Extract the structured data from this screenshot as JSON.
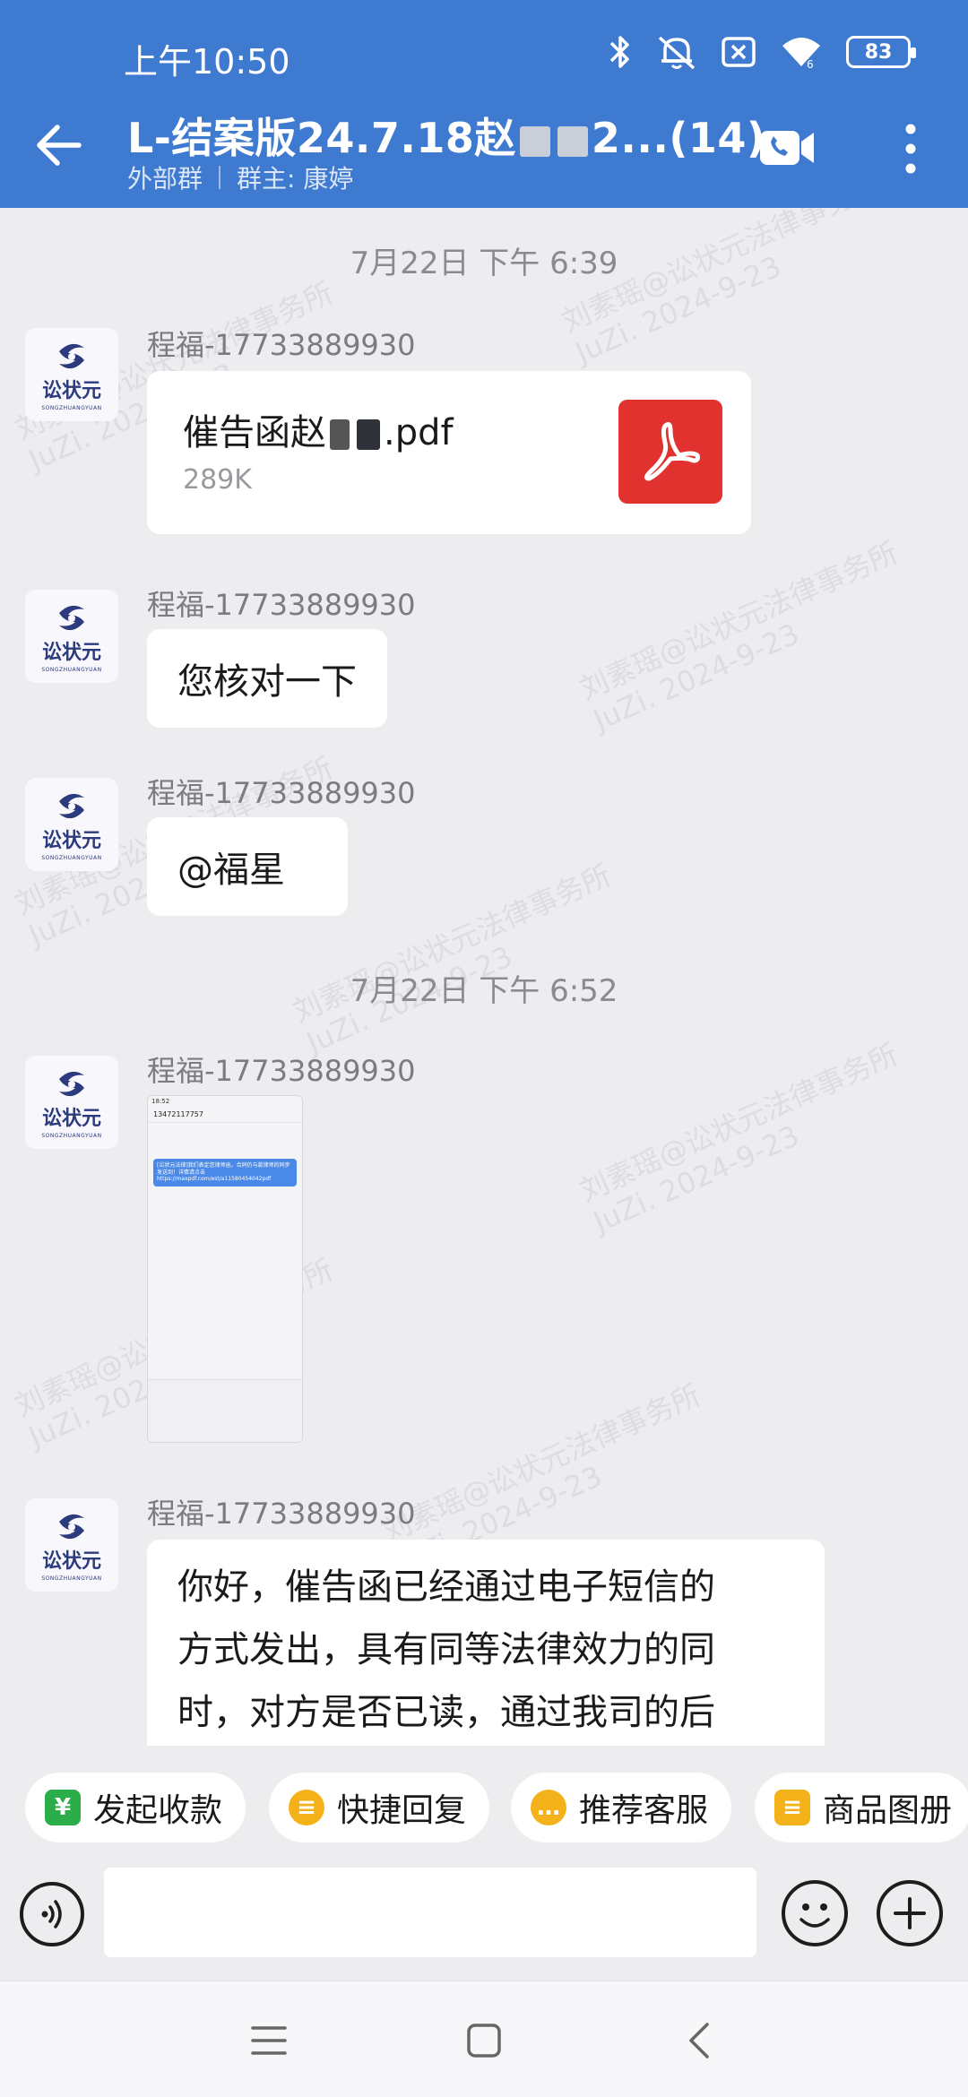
{
  "status_bar": {
    "time": "上午10:50",
    "battery": "83"
  },
  "header": {
    "title_prefix": "L-结案版24.7.18赵",
    "title_suffix": "2...(14)",
    "group_type": "外部群",
    "owner": "群主: 康婷"
  },
  "messages": [
    {
      "kind": "date",
      "text": "7月22日  下午 6:39"
    },
    {
      "kind": "file",
      "sender": "程福-17733889930",
      "file_prefix": "催告函赵",
      "file_ext": ".pdf",
      "file_size": "289K"
    },
    {
      "kind": "text",
      "sender": "程福-17733889930",
      "text": "您核对一下"
    },
    {
      "kind": "text",
      "sender": "程福-17733889930",
      "text": "@福星"
    },
    {
      "kind": "date",
      "text": "7月22日  下午 6:52"
    },
    {
      "kind": "image",
      "sender": "程福-17733889930",
      "thumb_time": "18:52",
      "thumb_number": "13472117757",
      "thumb_msg": "[讼状元法律]我们表定您律师函，合同仍与款律师的同步发送到！详情请点击https://maxpdf.com/est/a11580454042pdf"
    },
    {
      "kind": "text",
      "sender": "程福-17733889930",
      "lines": [
        "你好，催告函已经通过电子短信的",
        "方式发出，具有同等法律效力的同",
        "时，对方是否已读，通过我司的后"
      ]
    }
  ],
  "avatar": {
    "logo_text": "讼状元",
    "logo_sub": "SONGZHUANGYUAN"
  },
  "watermark": {
    "line1": "刘素瑶@讼状元法律事务所",
    "line2": "JuZi. 2024-9-23"
  },
  "quick_actions": [
    {
      "label": "发起收款",
      "icon": "¥",
      "color": "#2bae4a"
    },
    {
      "label": "快捷回复",
      "icon": "≡",
      "color": "#f4b21a"
    },
    {
      "label": "推荐客服",
      "icon": "…",
      "color": "#f4b21a"
    },
    {
      "label": "商品图册",
      "icon": "≡",
      "color": "#f4b21a"
    }
  ],
  "input": {
    "placeholder": ""
  }
}
